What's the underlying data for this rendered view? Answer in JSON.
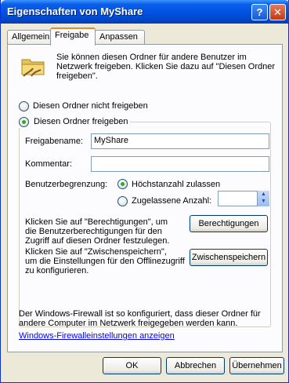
{
  "window": {
    "title": "Eigenschaften von MyShare",
    "help_label": "?",
    "close_label": "✕"
  },
  "tabs": [
    {
      "label": "Allgemein"
    },
    {
      "label": "Freigabe"
    },
    {
      "label": "Anpassen"
    }
  ],
  "sharing": {
    "intro_line1": "Sie können diesen Ordner für andere Benutzer im",
    "intro_line2": "Netzwerk freigeben. Klicken Sie dazu auf \"Diesen Ordner",
    "intro_line3": "freigeben\".",
    "option_not_share": "Diesen Ordner nicht freigeben",
    "option_share": "Diesen Ordner freigeben",
    "share_name_label": "Freigabename:",
    "share_name_value": "MyShare",
    "comment_label": "Kommentar:",
    "comment_value": "",
    "user_limit_label": "Benutzerbegrenzung:",
    "limit_max": "Höchstanzahl zulassen",
    "limit_allowed": "Zugelassene Anzahl:",
    "allowed_count_value": "",
    "perm_text_line1": "Klicken Sie auf \"Berechtigungen\", um",
    "perm_text_line2": "die Benutzerberechtigungen für den",
    "perm_text_line3": "Zugriff auf diesen Ordner festzulegen.",
    "permissions_button": "Berechtigungen",
    "cache_text_line1": "Klicken Sie auf \"Zwischenspeichern\",",
    "cache_text_line2": "um die Einstellungen für den Offlinezugriff",
    "cache_text_line3": "zu konfigurieren.",
    "caching_button": "Zwischenspeichern"
  },
  "firewall": {
    "text_line1": "Der Windows-Firewall ist so konfiguriert, dass dieser Ordner für",
    "text_line2": "andere Computer im Netzwerk freigegeben werden kann.",
    "link": "Windows-Firewalleinstellungen anzeigen"
  },
  "buttons": {
    "ok": "OK",
    "cancel": "Abbrechen",
    "apply": "Übernehmen"
  }
}
